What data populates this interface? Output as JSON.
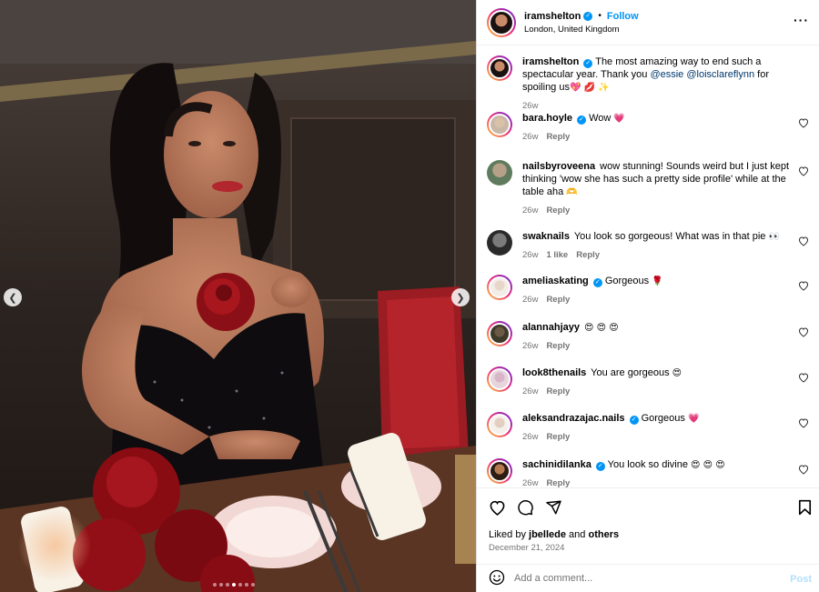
{
  "post": {
    "author": "iramshelton",
    "follow_label": "Follow",
    "location": "London, United Kingdom",
    "caption_prefix": "The most amazing way to end such a spectacular year. Thank you ",
    "mention1": "@essie",
    "mention2": "@loisclareflynn",
    "caption_suffix": " for spoiling us",
    "caption_emoji": "💖 💋 ✨",
    "caption_time": "26w"
  },
  "comments": [
    {
      "user": "bara.hoyle",
      "verified": true,
      "text": "Wow",
      "emoji": "💗",
      "time": "26w",
      "likes": "",
      "reply": "Reply"
    },
    {
      "user": "nailsbyroveena",
      "verified": false,
      "text": "wow stunning! Sounds weird but I just kept thinking 'wow she has such a pretty side profile' while at the table aha",
      "emoji": "🫶",
      "time": "26w",
      "likes": "",
      "reply": "Reply"
    },
    {
      "user": "swaknails",
      "verified": false,
      "text": "You look so gorgeous! What was in that pie",
      "emoji": "👀",
      "time": "26w",
      "likes": "1 like",
      "reply": "Reply"
    },
    {
      "user": "ameliaskating",
      "verified": true,
      "text": "Gorgeous",
      "emoji": "🌹",
      "time": "26w",
      "likes": "",
      "reply": "Reply"
    },
    {
      "user": "alannahjayy",
      "verified": false,
      "text": "",
      "emoji": "😍 😍 😍",
      "time": "26w",
      "likes": "",
      "reply": "Reply"
    },
    {
      "user": "look8thenails",
      "verified": false,
      "text": "You are gorgeous",
      "emoji": "😍",
      "time": "26w",
      "likes": "",
      "reply": "Reply"
    },
    {
      "user": "aleksandrazajac.nails",
      "verified": true,
      "text": "Gorgeous",
      "emoji": "💗",
      "time": "26w",
      "likes": "",
      "reply": "Reply"
    },
    {
      "user": "sachinidilanka",
      "verified": true,
      "text": "You look so divine",
      "emoji": "😍 😍 😍",
      "time": "26w",
      "likes": "",
      "reply": "Reply"
    }
  ],
  "engagement": {
    "liked_by_prefix": "Liked by ",
    "liked_by_user": "jbellede",
    "liked_by_mid": " and ",
    "liked_by_others": "others",
    "date": "December 21, 2024"
  },
  "composer": {
    "placeholder": "Add a comment...",
    "post_label": "Post"
  },
  "icons": {
    "more": "more-options-icon",
    "verified": "verified-badge-icon",
    "like": "heart-icon",
    "comment": "comment-icon",
    "share": "share-icon",
    "save": "bookmark-icon",
    "emoji": "emoji-icon",
    "prev": "chevron-left-icon",
    "next": "chevron-right-icon"
  },
  "carousel": {
    "slide_count": 7,
    "active_index": 3
  },
  "colors": {
    "accent": "#0095f6",
    "link": "#00376b",
    "muted": "#737373",
    "post_disabled": "#b2dffc"
  }
}
